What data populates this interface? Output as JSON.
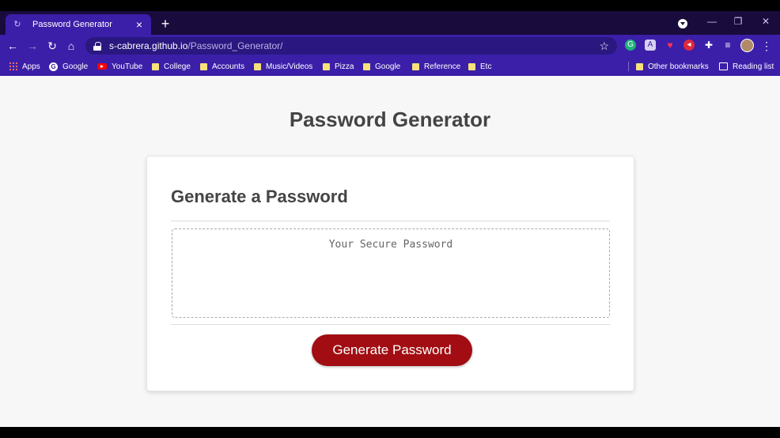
{
  "browser": {
    "tab": {
      "title": "Password Generator"
    },
    "address": {
      "host": "s-cabrera.github.io",
      "path": "/Password_Generator/"
    },
    "bookmarks": [
      {
        "label": "Apps",
        "icon": "apps-icon"
      },
      {
        "label": "Google",
        "icon": "google-icon"
      },
      {
        "label": "YouTube",
        "icon": "youtube-icon"
      },
      {
        "label": "College",
        "icon": "folder-icon"
      },
      {
        "label": "Accounts",
        "icon": "folder-icon"
      },
      {
        "label": "Music/Videos",
        "icon": "folder-icon"
      },
      {
        "label": "Pizza",
        "icon": "folder-icon"
      },
      {
        "label": "Google",
        "icon": "folder-icon"
      },
      {
        "label": "Reference",
        "icon": "folder-icon"
      },
      {
        "label": "Etc",
        "icon": "folder-icon"
      }
    ],
    "other_bookmarks": "Other bookmarks",
    "reading_list": "Reading list",
    "colors": {
      "frame": "#1a0b3d",
      "toolbar": "#3b1fa8"
    }
  },
  "page": {
    "title": "Password Generator",
    "card": {
      "header": "Generate a Password",
      "password_placeholder": "Your Secure Password",
      "generate_label": "Generate Password"
    },
    "colors": {
      "button": "#a10d12",
      "heading": "#444444"
    }
  }
}
